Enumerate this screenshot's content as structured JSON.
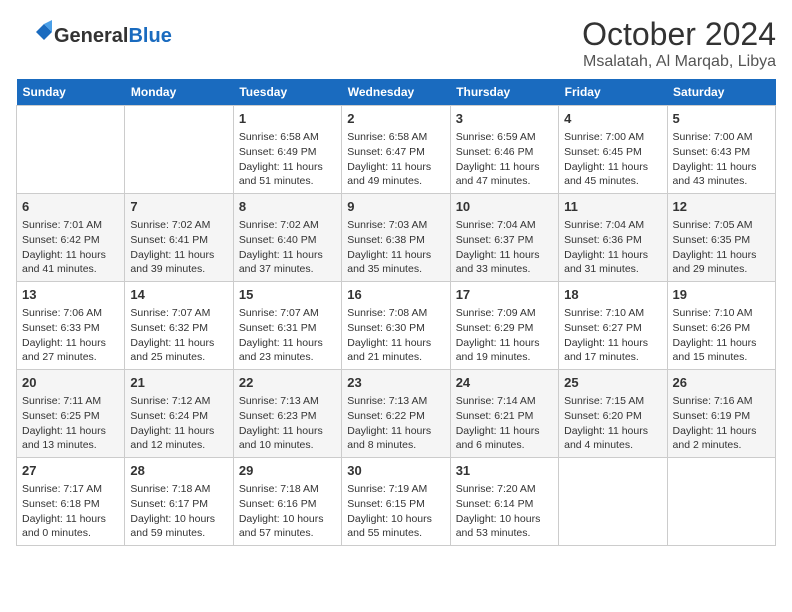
{
  "header": {
    "logo_general": "General",
    "logo_blue": "Blue",
    "month": "October 2024",
    "location": "Msalatah, Al Marqab, Libya"
  },
  "weekdays": [
    "Sunday",
    "Monday",
    "Tuesday",
    "Wednesday",
    "Thursday",
    "Friday",
    "Saturday"
  ],
  "weeks": [
    [
      {
        "day": "",
        "info": ""
      },
      {
        "day": "",
        "info": ""
      },
      {
        "day": "1",
        "info": "Sunrise: 6:58 AM\nSunset: 6:49 PM\nDaylight: 11 hours and 51 minutes."
      },
      {
        "day": "2",
        "info": "Sunrise: 6:58 AM\nSunset: 6:47 PM\nDaylight: 11 hours and 49 minutes."
      },
      {
        "day": "3",
        "info": "Sunrise: 6:59 AM\nSunset: 6:46 PM\nDaylight: 11 hours and 47 minutes."
      },
      {
        "day": "4",
        "info": "Sunrise: 7:00 AM\nSunset: 6:45 PM\nDaylight: 11 hours and 45 minutes."
      },
      {
        "day": "5",
        "info": "Sunrise: 7:00 AM\nSunset: 6:43 PM\nDaylight: 11 hours and 43 minutes."
      }
    ],
    [
      {
        "day": "6",
        "info": "Sunrise: 7:01 AM\nSunset: 6:42 PM\nDaylight: 11 hours and 41 minutes."
      },
      {
        "day": "7",
        "info": "Sunrise: 7:02 AM\nSunset: 6:41 PM\nDaylight: 11 hours and 39 minutes."
      },
      {
        "day": "8",
        "info": "Sunrise: 7:02 AM\nSunset: 6:40 PM\nDaylight: 11 hours and 37 minutes."
      },
      {
        "day": "9",
        "info": "Sunrise: 7:03 AM\nSunset: 6:38 PM\nDaylight: 11 hours and 35 minutes."
      },
      {
        "day": "10",
        "info": "Sunrise: 7:04 AM\nSunset: 6:37 PM\nDaylight: 11 hours and 33 minutes."
      },
      {
        "day": "11",
        "info": "Sunrise: 7:04 AM\nSunset: 6:36 PM\nDaylight: 11 hours and 31 minutes."
      },
      {
        "day": "12",
        "info": "Sunrise: 7:05 AM\nSunset: 6:35 PM\nDaylight: 11 hours and 29 minutes."
      }
    ],
    [
      {
        "day": "13",
        "info": "Sunrise: 7:06 AM\nSunset: 6:33 PM\nDaylight: 11 hours and 27 minutes."
      },
      {
        "day": "14",
        "info": "Sunrise: 7:07 AM\nSunset: 6:32 PM\nDaylight: 11 hours and 25 minutes."
      },
      {
        "day": "15",
        "info": "Sunrise: 7:07 AM\nSunset: 6:31 PM\nDaylight: 11 hours and 23 minutes."
      },
      {
        "day": "16",
        "info": "Sunrise: 7:08 AM\nSunset: 6:30 PM\nDaylight: 11 hours and 21 minutes."
      },
      {
        "day": "17",
        "info": "Sunrise: 7:09 AM\nSunset: 6:29 PM\nDaylight: 11 hours and 19 minutes."
      },
      {
        "day": "18",
        "info": "Sunrise: 7:10 AM\nSunset: 6:27 PM\nDaylight: 11 hours and 17 minutes."
      },
      {
        "day": "19",
        "info": "Sunrise: 7:10 AM\nSunset: 6:26 PM\nDaylight: 11 hours and 15 minutes."
      }
    ],
    [
      {
        "day": "20",
        "info": "Sunrise: 7:11 AM\nSunset: 6:25 PM\nDaylight: 11 hours and 13 minutes."
      },
      {
        "day": "21",
        "info": "Sunrise: 7:12 AM\nSunset: 6:24 PM\nDaylight: 11 hours and 12 minutes."
      },
      {
        "day": "22",
        "info": "Sunrise: 7:13 AM\nSunset: 6:23 PM\nDaylight: 11 hours and 10 minutes."
      },
      {
        "day": "23",
        "info": "Sunrise: 7:13 AM\nSunset: 6:22 PM\nDaylight: 11 hours and 8 minutes."
      },
      {
        "day": "24",
        "info": "Sunrise: 7:14 AM\nSunset: 6:21 PM\nDaylight: 11 hours and 6 minutes."
      },
      {
        "day": "25",
        "info": "Sunrise: 7:15 AM\nSunset: 6:20 PM\nDaylight: 11 hours and 4 minutes."
      },
      {
        "day": "26",
        "info": "Sunrise: 7:16 AM\nSunset: 6:19 PM\nDaylight: 11 hours and 2 minutes."
      }
    ],
    [
      {
        "day": "27",
        "info": "Sunrise: 7:17 AM\nSunset: 6:18 PM\nDaylight: 11 hours and 0 minutes."
      },
      {
        "day": "28",
        "info": "Sunrise: 7:18 AM\nSunset: 6:17 PM\nDaylight: 10 hours and 59 minutes."
      },
      {
        "day": "29",
        "info": "Sunrise: 7:18 AM\nSunset: 6:16 PM\nDaylight: 10 hours and 57 minutes."
      },
      {
        "day": "30",
        "info": "Sunrise: 7:19 AM\nSunset: 6:15 PM\nDaylight: 10 hours and 55 minutes."
      },
      {
        "day": "31",
        "info": "Sunrise: 7:20 AM\nSunset: 6:14 PM\nDaylight: 10 hours and 53 minutes."
      },
      {
        "day": "",
        "info": ""
      },
      {
        "day": "",
        "info": ""
      }
    ]
  ]
}
